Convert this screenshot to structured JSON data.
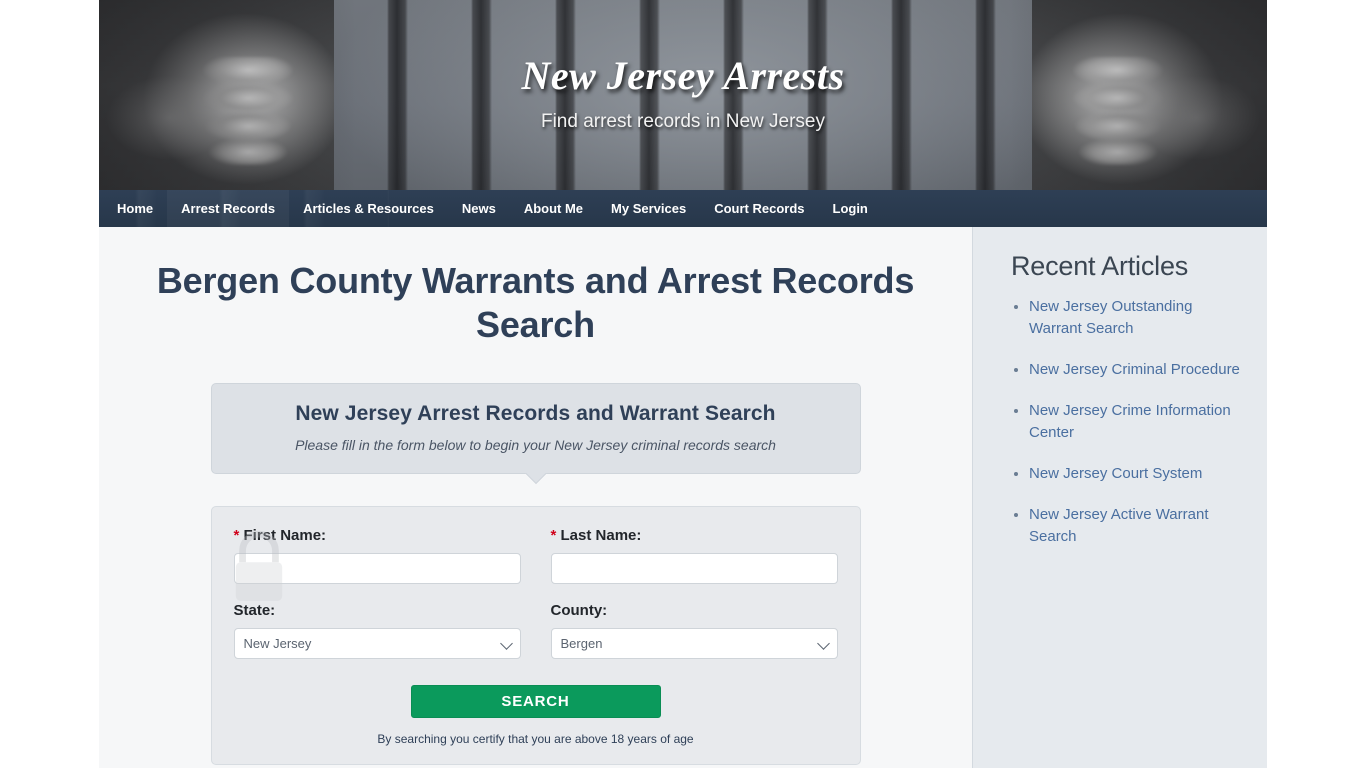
{
  "masthead": {
    "title": "New Jersey Arrests",
    "tagline": "Find arrest records in New Jersey"
  },
  "nav": {
    "items": [
      {
        "label": "Home",
        "active": false
      },
      {
        "label": "Arrest Records",
        "active": true
      },
      {
        "label": "Articles & Resources",
        "active": false
      },
      {
        "label": "News",
        "active": false
      },
      {
        "label": "About Me",
        "active": false
      },
      {
        "label": "My Services",
        "active": false
      },
      {
        "label": "Court Records",
        "active": false
      },
      {
        "label": "Login",
        "active": false
      }
    ]
  },
  "main": {
    "page_title": "Bergen County Warrants and Arrest Records Search",
    "callout": {
      "heading": "New Jersey Arrest Records and Warrant Search",
      "subtext": "Please fill in the form below to begin your New Jersey criminal records search"
    },
    "form": {
      "first_name": {
        "label": "First Name:",
        "required_marker": "*",
        "value": "",
        "placeholder": ""
      },
      "last_name": {
        "label": "Last Name:",
        "required_marker": "*",
        "value": "",
        "placeholder": ""
      },
      "state": {
        "label": "State:",
        "value": "New Jersey",
        "options": [
          "New Jersey"
        ]
      },
      "county": {
        "label": "County:",
        "value": "Bergen",
        "options": [
          "Bergen"
        ]
      },
      "submit_label": "SEARCH",
      "disclaimer": "By searching you certify that you are above 18 years of age"
    }
  },
  "sidebar": {
    "title": "Recent Articles",
    "articles": [
      {
        "label": "New Jersey Outstanding Warrant Search"
      },
      {
        "label": "New Jersey Criminal Procedure"
      },
      {
        "label": "New Jersey Crime Information Center"
      },
      {
        "label": "New Jersey Court System"
      },
      {
        "label": "New Jersey Active Warrant Search"
      }
    ]
  },
  "colors": {
    "nav_background": "#2e3f55",
    "heading": "#2f4058",
    "link": "#4a6fa0",
    "search_button": "#0b9a5c",
    "required_marker": "#d0021b",
    "sidebar_background": "#e6eaee",
    "content_background": "#f6f7f8"
  }
}
